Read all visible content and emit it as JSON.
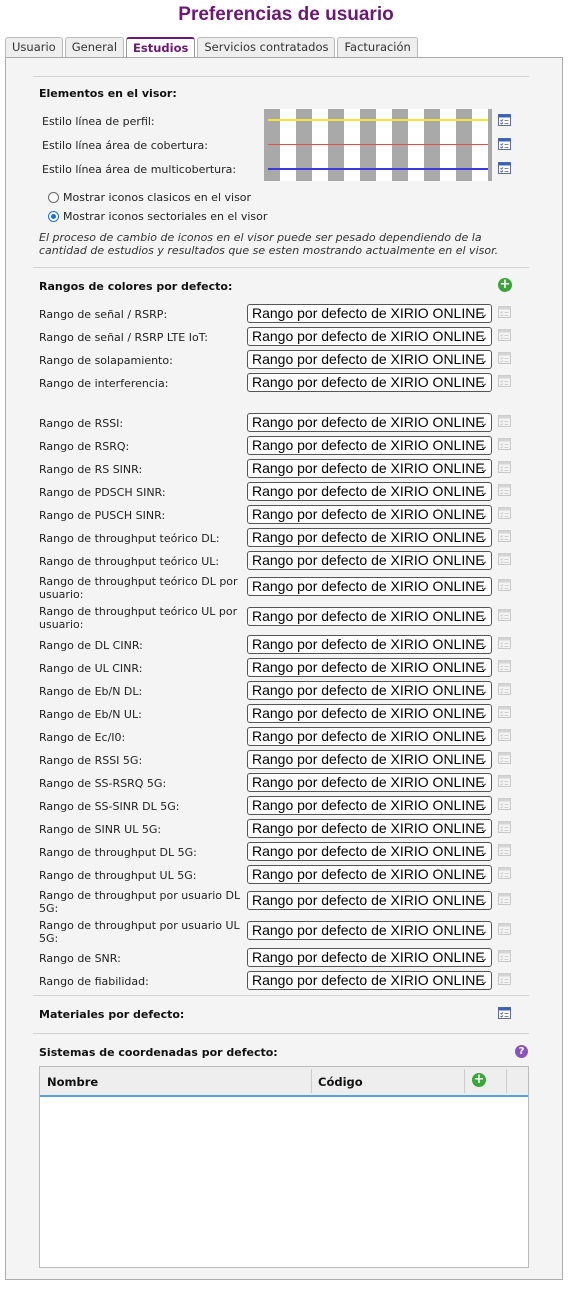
{
  "page_title": "Preferencias de usuario",
  "tabs": [
    {
      "label": "Usuario"
    },
    {
      "label": "General"
    },
    {
      "label": "Estudios",
      "active": true
    },
    {
      "label": "Servicios contratados"
    },
    {
      "label": "Facturación"
    }
  ],
  "viewer": {
    "title": "Elementos en el visor:",
    "line_styles": [
      {
        "label": "Estilo línea de perfil:",
        "color": "#f2e63a"
      },
      {
        "label": "Estilo línea área de cobertura:",
        "color": "#e05050"
      },
      {
        "label": "Estilo línea área de multicobertura:",
        "color": "#3a3ad8"
      }
    ],
    "icon_options": [
      {
        "label": "Mostrar iconos clasicos en el visor",
        "selected": false
      },
      {
        "label": "Mostrar iconos sectoriales en el visor",
        "selected": true
      }
    ],
    "note": "El proceso de cambio de iconos en el visor puede ser pesado dependiendo de la cantidad de estudios y resultados que se esten mostrando actualmente en el visor."
  },
  "color_ranges": {
    "title": "Rangos de colores por defecto:",
    "default_option": "Rango por defecto de XIRIO ONLINE",
    "items": [
      {
        "label": "Rango de señal / RSRP:"
      },
      {
        "label": "Rango de señal / RSRP LTE IoT:"
      },
      {
        "label": "Rango de solapamiento:"
      },
      {
        "label": "Rango de interferencia:"
      },
      {
        "label": "Rango de RSSI:"
      },
      {
        "label": "Rango de RSRQ:"
      },
      {
        "label": "Rango de RS SINR:"
      },
      {
        "label": "Rango de PDSCH SINR:"
      },
      {
        "label": "Rango de PUSCH SINR:"
      },
      {
        "label": "Rango de throughput teórico DL:"
      },
      {
        "label": "Rango de throughput teórico UL:"
      },
      {
        "label": "Rango de throughput teórico DL por usuario:"
      },
      {
        "label": "Rango de throughput teórico UL por usuario:"
      },
      {
        "label": "Rango de DL CINR:"
      },
      {
        "label": "Rango de UL CINR:"
      },
      {
        "label": "Rango de Eb/N DL:"
      },
      {
        "label": "Rango de Eb/N UL:"
      },
      {
        "label": "Rango de Ec/I0:"
      },
      {
        "label": "Rango de RSSI 5G:"
      },
      {
        "label": "Rango de SS-RSRQ 5G:"
      },
      {
        "label": "Rango de SS-SINR DL 5G:"
      },
      {
        "label": "Rango de SINR UL 5G:"
      },
      {
        "label": "Rango de throughput DL 5G:"
      },
      {
        "label": "Rango de throughput UL 5G:"
      },
      {
        "label": "Rango de throughput por usuario DL 5G:"
      },
      {
        "label": "Rango de throughput por usuario UL 5G:"
      },
      {
        "label": "Rango de SNR:"
      },
      {
        "label": "Rango de fiabilidad:"
      }
    ]
  },
  "materials": {
    "title": "Materiales por defecto:"
  },
  "coordinates": {
    "title": "Sistemas de coordenadas por defecto:",
    "columns": [
      "Nombre",
      "Código"
    ]
  }
}
